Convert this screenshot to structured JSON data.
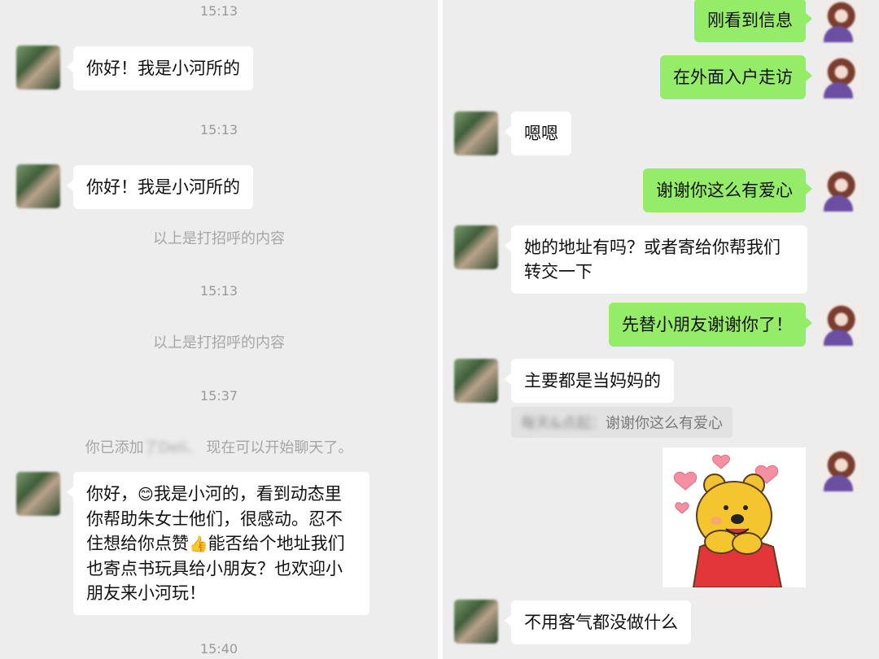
{
  "left_panel": {
    "messages": [
      {
        "time": "15:13",
        "text": "你好！我是小河所的"
      },
      {
        "time": "15:13",
        "text": "你好！我是小河所的"
      }
    ],
    "system_1": "以上是打招呼的内容",
    "time_3": "15:13",
    "system_2": "以上是打招呼的内容",
    "time_4": "15:37",
    "added_prefix": "你已添加",
    "added_name": "了Deli、",
    "added_suffix": "现在可以开始聊天了。",
    "long_message": {
      "line1a": "你好，",
      "line1b": "我是小河的，看到动态里",
      "line2": "你帮助朱女士他们，很感动。忍不",
      "line3a": "住想给你点赞",
      "line3b": "能否给个地址我们",
      "line4": "也寄点书玩具给小朋友？也欢迎小",
      "line5": "朋友来小河玩！",
      "emoji_smile": "😊",
      "emoji_thumb": "👍"
    },
    "time_5": "15:40"
  },
  "right_panel": {
    "out_1": "刚看到信息",
    "out_2": "在外面入户走访",
    "in_1": "嗯嗯",
    "out_3": "谢谢你这么有爱心",
    "in_2_line1": "她的地址有吗？或者寄给你帮我们",
    "in_2_line2": "转交一下",
    "out_4": "先替小朋友谢谢你了！",
    "in_3": "主要都是当妈妈的",
    "quote_name": "每天&点起：",
    "quote_text": "谢谢你这么有爱心",
    "in_4": "不用客气都没做什么"
  }
}
